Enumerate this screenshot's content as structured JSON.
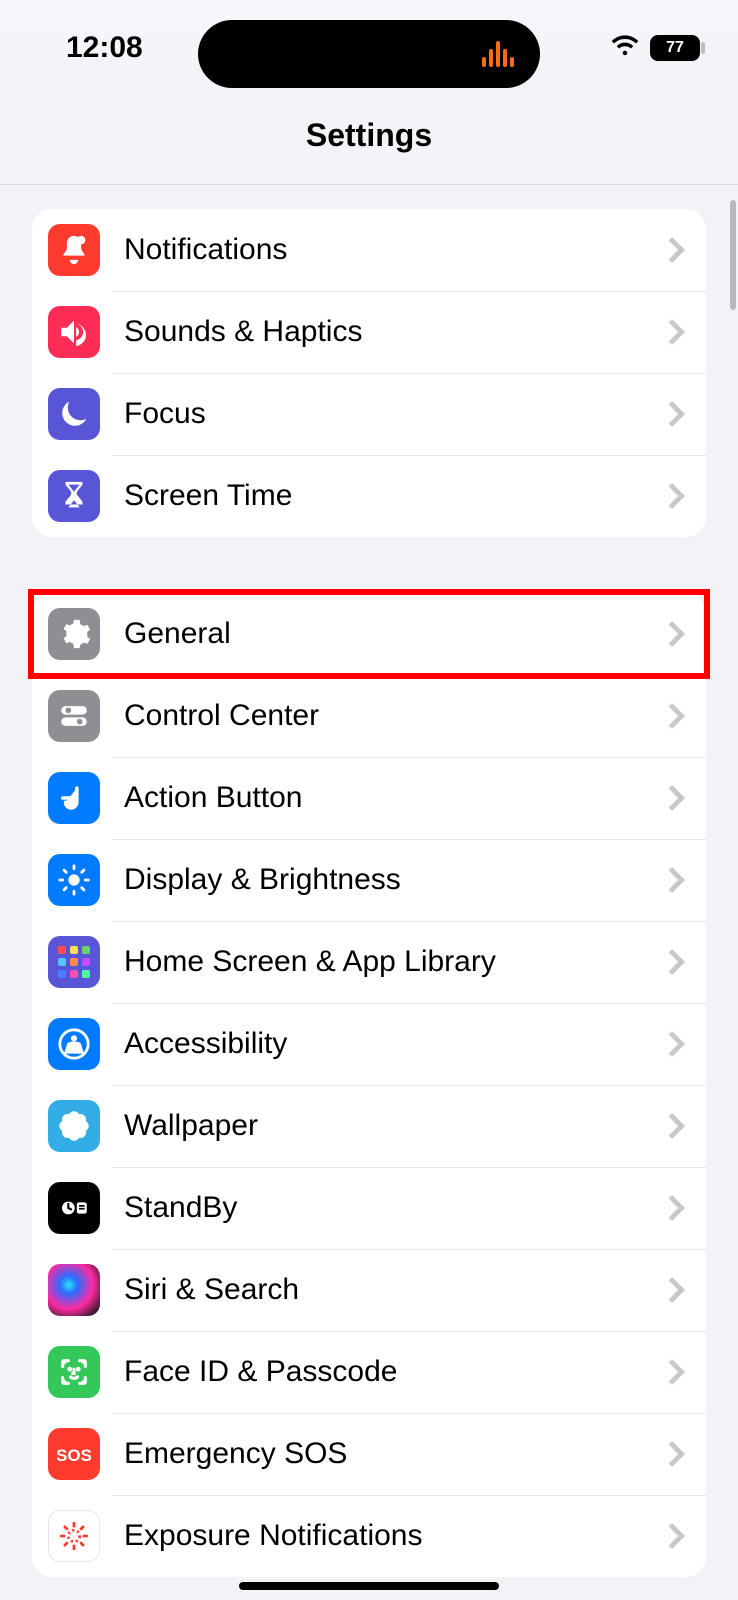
{
  "statusBar": {
    "time": "12:08",
    "batteryPercent": "77"
  },
  "headerTitle": "Settings",
  "highlightRowIndex": 4,
  "groups": [
    {
      "rows": [
        {
          "id": "notifications",
          "label": "Notifications",
          "iconName": "bell-icon",
          "iconBg": "bg-red"
        },
        {
          "id": "sounds-haptics",
          "label": "Sounds & Haptics",
          "iconName": "speaker-icon",
          "iconBg": "bg-pink"
        },
        {
          "id": "focus",
          "label": "Focus",
          "iconName": "moon-icon",
          "iconBg": "bg-indigo"
        },
        {
          "id": "screen-time",
          "label": "Screen Time",
          "iconName": "hourglass-icon",
          "iconBg": "bg-indigo"
        }
      ]
    },
    {
      "rows": [
        {
          "id": "general",
          "label": "General",
          "iconName": "gear-icon",
          "iconBg": "bg-gray"
        },
        {
          "id": "control-center",
          "label": "Control Center",
          "iconName": "switches-icon",
          "iconBg": "bg-gray"
        },
        {
          "id": "action-button",
          "label": "Action Button",
          "iconName": "action-icon",
          "iconBg": "bg-blue"
        },
        {
          "id": "display-brightness",
          "label": "Display & Brightness",
          "iconName": "sun-icon",
          "iconBg": "bg-blue"
        },
        {
          "id": "home-screen-library",
          "label": "Home Screen & App Library",
          "iconName": "grid-icon",
          "iconBg": "bg-indigo"
        },
        {
          "id": "accessibility",
          "label": "Accessibility",
          "iconName": "person-icon",
          "iconBg": "bg-blue"
        },
        {
          "id": "wallpaper",
          "label": "Wallpaper",
          "iconName": "flower-icon",
          "iconBg": "bg-cyan"
        },
        {
          "id": "standby",
          "label": "StandBy",
          "iconName": "standby-icon",
          "iconBg": "bg-black"
        },
        {
          "id": "siri-search",
          "label": "Siri & Search",
          "iconName": "siri-icon",
          "iconBg": "bg-siri"
        },
        {
          "id": "faceid-passcode",
          "label": "Face ID & Passcode",
          "iconName": "faceid-icon",
          "iconBg": "bg-green"
        },
        {
          "id": "emergency-sos",
          "label": "Emergency SOS",
          "iconName": "sos-icon",
          "iconBg": "bg-red"
        },
        {
          "id": "exposure-notifications",
          "label": "Exposure Notifications",
          "iconName": "exposure-icon",
          "iconBg": "bg-white"
        }
      ]
    }
  ]
}
